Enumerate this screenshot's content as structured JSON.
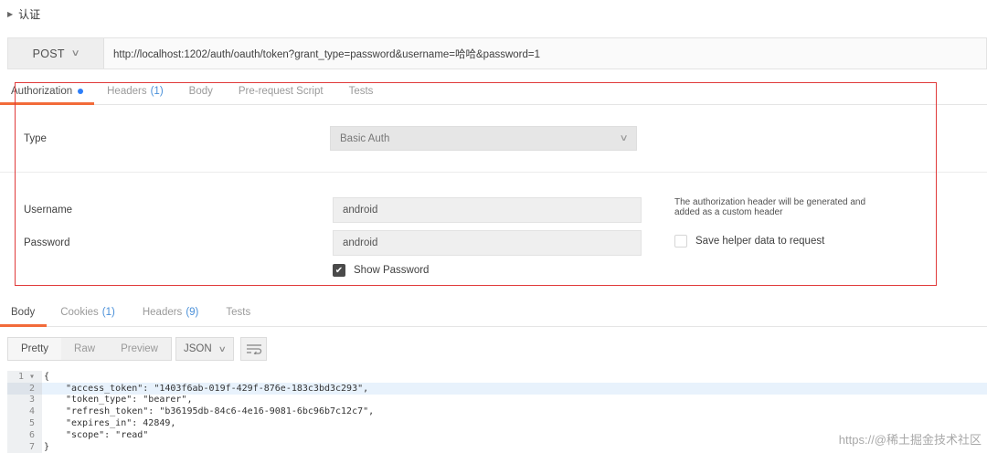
{
  "section_title": "认证",
  "request": {
    "method": "POST",
    "url": "http://localhost:1202/auth/oauth/token?grant_type=password&username=哈哈&password=1"
  },
  "request_tabs": [
    {
      "label": "Authorization",
      "count": ""
    },
    {
      "label": "Headers",
      "count": "(1)"
    },
    {
      "label": "Body",
      "count": ""
    },
    {
      "label": "Pre-request Script",
      "count": ""
    },
    {
      "label": "Tests",
      "count": ""
    }
  ],
  "auth": {
    "type_label": "Type",
    "type_value": "Basic Auth",
    "username_label": "Username",
    "username_value": "android",
    "password_label": "Password",
    "password_value": "android",
    "show_password_label": "Show Password",
    "hint": "The authorization header will be generated and added as a custom header",
    "save_helper_label": "Save helper data to request"
  },
  "response_tabs": [
    {
      "label": "Body",
      "count": ""
    },
    {
      "label": "Cookies",
      "count": "(1)"
    },
    {
      "label": "Headers",
      "count": "(9)"
    },
    {
      "label": "Tests",
      "count": ""
    }
  ],
  "view_modes": [
    "Pretty",
    "Raw",
    "Preview"
  ],
  "format": "JSON",
  "code": {
    "line_numbers": [
      "1",
      "2",
      "3",
      "4",
      "5",
      "6",
      "7"
    ],
    "first_line_fold": "1 ▾",
    "lines": [
      "{",
      "\"access_token\": \"1403f6ab-019f-429f-876e-183c3bd3c293\",",
      "\"token_type\": \"bearer\",",
      "\"refresh_token\": \"b36195db-84c6-4e16-9081-6bc96b7c12c7\",",
      "\"expires_in\": 42849,",
      "\"scope\": \"read\"",
      "}"
    ]
  },
  "watermark": "https://@稀土掘金技术社区",
  "colors": {
    "accent_tab_underline": "#f26b3a",
    "count_blue": "#4a90d9",
    "status_dot": "#2d7ff9",
    "annotation_box": "#e03a3a"
  }
}
